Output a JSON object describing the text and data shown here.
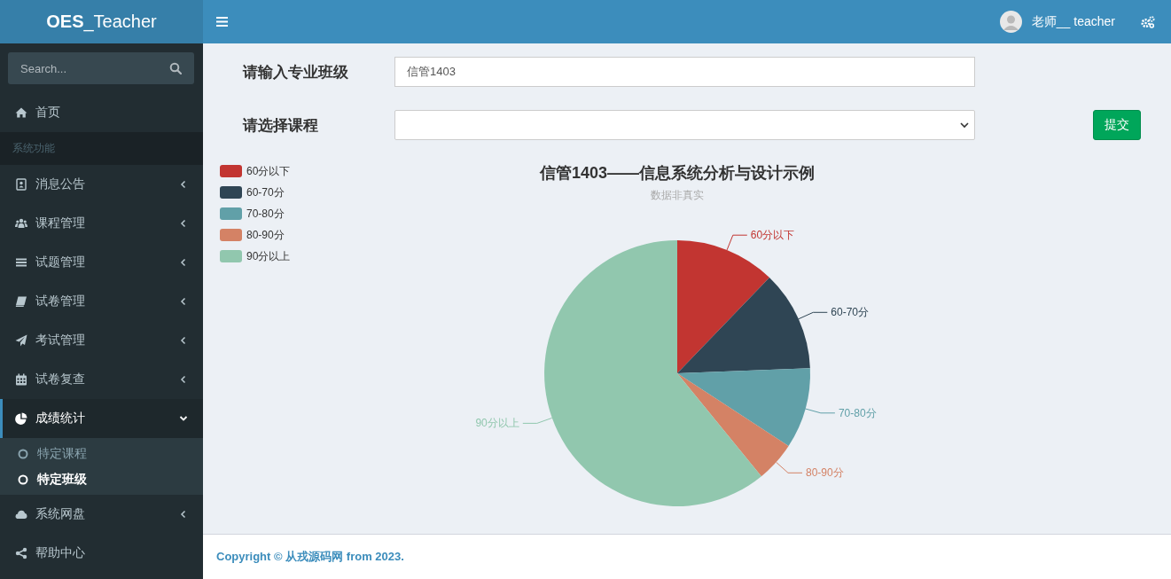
{
  "brand": {
    "bold": "OES",
    "rest": "_Teacher"
  },
  "user": {
    "name": "老师__ teacher"
  },
  "sidebar": {
    "search": {
      "placeholder": "Search..."
    },
    "items": [
      {
        "label": "首页",
        "kind": "link"
      },
      {
        "label": "系统功能",
        "kind": "header"
      },
      {
        "label": "消息公告",
        "kind": "menu",
        "expanded": false
      },
      {
        "label": "课程管理",
        "kind": "menu",
        "expanded": false
      },
      {
        "label": "试题管理",
        "kind": "menu",
        "expanded": false
      },
      {
        "label": "试卷管理",
        "kind": "menu",
        "expanded": false
      },
      {
        "label": "考试管理",
        "kind": "menu",
        "expanded": false
      },
      {
        "label": "试卷复查",
        "kind": "menu",
        "expanded": false
      },
      {
        "label": "成绩统计",
        "kind": "menu",
        "expanded": true,
        "children": [
          {
            "label": "特定课程",
            "selected": false
          },
          {
            "label": "特定班级",
            "selected": true
          }
        ]
      },
      {
        "label": "系统网盘",
        "kind": "menu",
        "expanded": false
      },
      {
        "label": "帮助中心",
        "kind": "link"
      }
    ]
  },
  "form": {
    "class_label": "请输入专业班级",
    "class_value": "信管1403",
    "course_label": "请选择课程",
    "submit": "提交"
  },
  "chart": {
    "chart_data": {
      "type": "pie",
      "title": "信管1403——信息系统分析与设计示例",
      "subtitle": "数据非真实",
      "categories": [
        "60分以下",
        "60-70分",
        "70-80分",
        "80-90分",
        "90分以上"
      ],
      "legend": true,
      "series": [
        {
          "values": [
            12.2,
            12.2,
            9.8,
            4.9,
            60.9
          ],
          "colors": [
            "#c23531",
            "#2f4554",
            "#61a0a8",
            "#d48265",
            "#91c7ae"
          ]
        }
      ]
    }
  },
  "footer": {
    "copyright": "Copyright © 从戎源码网 from 2023."
  }
}
